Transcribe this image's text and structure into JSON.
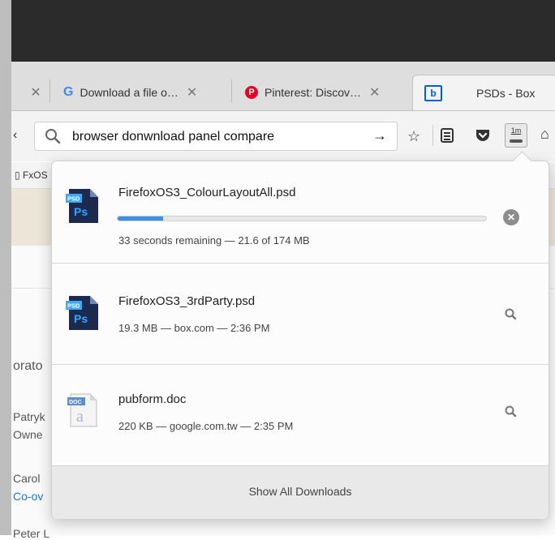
{
  "browser": {
    "tabs": [
      {
        "title": "",
        "active": false
      },
      {
        "title": "Download a file o…",
        "favicon": "google-favicon",
        "active": false
      },
      {
        "title": "Pinterest: Discov…",
        "favicon": "pinterest-favicon",
        "active": false
      },
      {
        "title": "PSDs - Box",
        "favicon": "box-favicon",
        "active": true
      }
    ],
    "url_bar": {
      "value": "browser donwnload panel compare",
      "go_icon": "arrow-right-icon"
    },
    "toolbar_icons": [
      "bookmark-star-icon",
      "reading-list-icon",
      "pocket-icon",
      "downloads-icon"
    ],
    "downloads_button_label": "1m",
    "bookmark_toolbar_item": "FxOS"
  },
  "page_behind": {
    "fragments": [
      "orato",
      "Patryk",
      "Owne",
      "Carol",
      "Co-ov",
      "Peter L"
    ]
  },
  "downloads_panel": {
    "items": [
      {
        "filename": "FirefoxOS3_ColourLayoutAll.psd",
        "status": "33 seconds remaining — 21.6 of 174 MB",
        "icon": "photoshop-file-icon",
        "icon_badge": "PSD",
        "icon_label": "Ps",
        "progress": 0.124,
        "action": "cancel-icon"
      },
      {
        "filename": "FirefoxOS3_3rdParty.psd",
        "status": "19.3 MB — box.com — 2:36 PM",
        "icon": "photoshop-file-icon",
        "icon_badge": "PSD",
        "icon_label": "Ps",
        "action": "magnifier-icon"
      },
      {
        "filename": "pubform.doc",
        "status": "220 KB — google.com.tw — 2:35 PM",
        "icon": "word-document-icon",
        "icon_badge": "DOC",
        "icon_label": "a",
        "action": "magnifier-icon"
      }
    ],
    "footer_label": "Show All Downloads"
  },
  "colors": {
    "progress": "#3c8fe6",
    "titlebar": "#2b2b2b",
    "panel_background": "#fcfcfc"
  }
}
